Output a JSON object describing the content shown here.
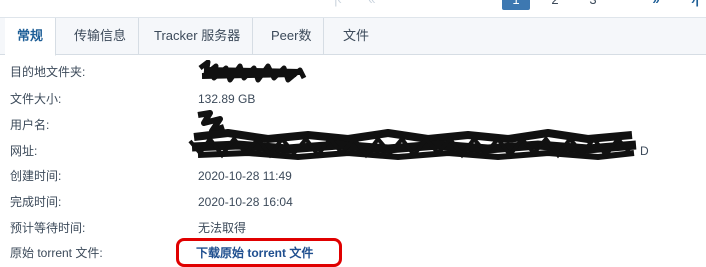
{
  "pagination": {
    "first_icon": "double-chevron-left-icon",
    "prev_icon": "chevron-left-icon",
    "pages": [
      "1",
      "2",
      "3"
    ],
    "active_page": "1",
    "next_icon": "double-chevron-right-icon",
    "last_icon": "chevron-right-bar-icon"
  },
  "tabs": [
    {
      "label": "常规",
      "active": true
    },
    {
      "label": "传输信息",
      "active": false
    },
    {
      "label": "Tracker 服务器",
      "active": false
    },
    {
      "label": "Peer数",
      "active": false
    },
    {
      "label": "文件",
      "active": false
    }
  ],
  "details": {
    "destination": {
      "label": "目的地文件夹:",
      "value_redacted": true
    },
    "size": {
      "label": "文件大小:",
      "value": "132.89 GB"
    },
    "username": {
      "label": "用户名:",
      "value_redacted": true
    },
    "url": {
      "label": "网址:",
      "value_redacted": true,
      "visible_tail": "D"
    },
    "created": {
      "label": "创建时间:",
      "value": "2020-10-28 11:49"
    },
    "completed": {
      "label": "完成时间:",
      "value": "2020-10-28 16:04"
    },
    "eta": {
      "label": "预计等待时间:",
      "value": "无法取得"
    },
    "torrent": {
      "label": "原始 torrent 文件:",
      "link_text": "下载原始 torrent 文件"
    }
  },
  "colors": {
    "accent": "#3d78b1",
    "link": "#1f4f8f",
    "highlight": "#e00000",
    "redaction": "#111111"
  }
}
